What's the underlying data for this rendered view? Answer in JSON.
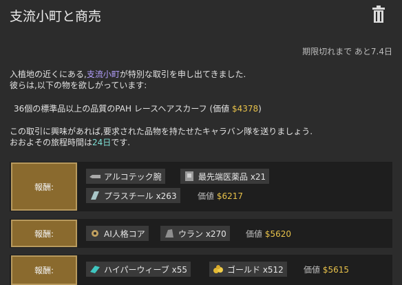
{
  "title": "支流小町と商売",
  "expiry": "期限切れまで あと7.4日",
  "intro": {
    "line1_prefix": "入植地の近くにある,",
    "faction": "支流小町",
    "line1_suffix": "が特別な取引を申し出てきました.",
    "line2": "彼らは,以下の物を欲しがっています:"
  },
  "request": {
    "text": "36個の標準品以上の品質のPAH レースヘアスカーフ (価値 ",
    "price": "$4378",
    "close": ")"
  },
  "closing": {
    "line1": "この取引に興味があれば,要求された品物を持たせたキャラバン隊を送りましょう.",
    "line2_prefix": "おおよその旅程時間は",
    "days": "24日",
    "line2_suffix": "です."
  },
  "value_label": "価値",
  "rewards": [
    {
      "button": "報酬:",
      "items": [
        {
          "icon": "bionic-arm-icon",
          "label": "アルコテック腕"
        },
        {
          "icon": "medicine-icon",
          "label": "最先端医薬品 x21"
        },
        {
          "icon": "plasteel-icon",
          "label": "プラスチール x263"
        }
      ],
      "value": "$6217"
    },
    {
      "button": "報酬:",
      "items": [
        {
          "icon": "ai-core-icon",
          "label": "AI人格コア"
        },
        {
          "icon": "uranium-icon",
          "label": "ウラン x270"
        }
      ],
      "value": "$5620"
    },
    {
      "button": "報酬:",
      "items": [
        {
          "icon": "hyperweave-icon",
          "label": "ハイパーウィーブ x55"
        },
        {
          "icon": "gold-icon",
          "label": "ゴールド x512"
        }
      ],
      "value": "$5615"
    }
  ],
  "colors": {
    "faction": "#b4a0ff",
    "money": "#e8c24a",
    "days": "#7fe0d6",
    "button": "#8a6a2e"
  }
}
